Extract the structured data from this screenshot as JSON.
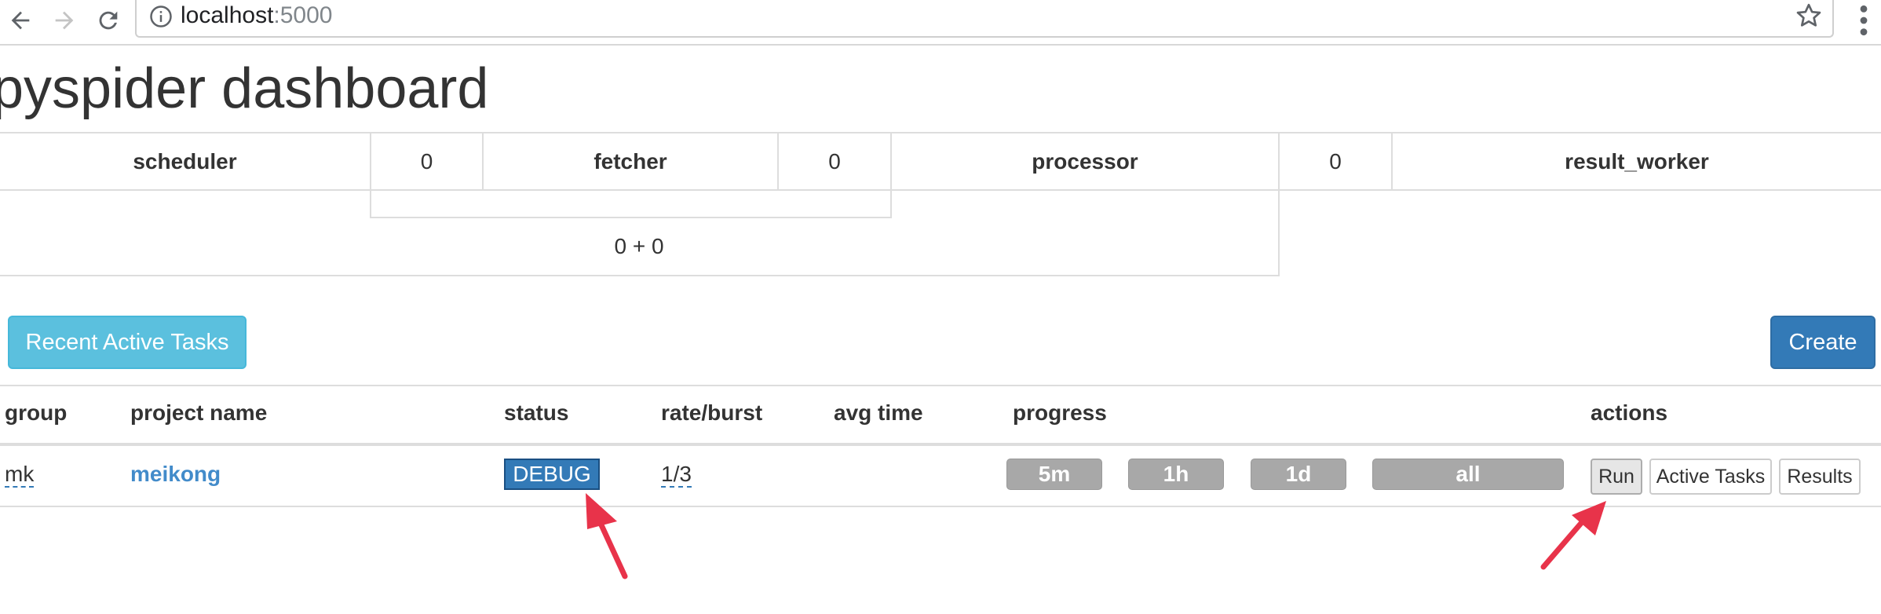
{
  "browser": {
    "url_host": "localhost",
    "url_port": ":5000"
  },
  "page": {
    "title": "pyspider dashboard"
  },
  "queues": {
    "scheduler_label": "scheduler",
    "scheduler_to_fetcher": "0",
    "fetcher_label": "fetcher",
    "fetcher_to_processor": "0",
    "processor_label": "processor",
    "processor_to_result": "0",
    "result_worker_label": "result_worker",
    "fetcher_detail": "0 + 0"
  },
  "toolbar": {
    "recent_tasks_label": "Recent Active Tasks",
    "create_label": "Create"
  },
  "projects_table": {
    "headers": {
      "group": "group",
      "project_name": "project name",
      "status": "status",
      "rate_burst": "rate/burst",
      "avg_time": "avg time",
      "progress": "progress",
      "actions": "actions"
    },
    "rows": [
      {
        "group": "mk",
        "project_name": "meikong",
        "status": "DEBUG",
        "rate_burst": "1/3",
        "avg_time": "",
        "progress": [
          "5m",
          "1h",
          "1d",
          "all"
        ],
        "actions": {
          "run": "Run",
          "active_tasks": "Active Tasks",
          "results": "Results"
        }
      }
    ]
  },
  "colors": {
    "info_button": "#5bc0de",
    "primary_button": "#337ab7",
    "progress_pill": "#a8a8a8",
    "annotation_arrow": "#e8334a"
  }
}
